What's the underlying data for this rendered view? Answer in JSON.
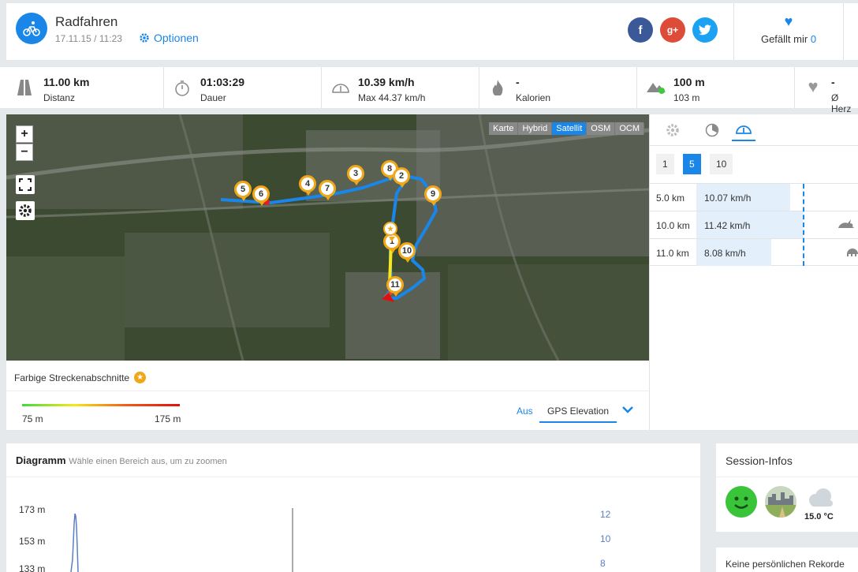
{
  "header": {
    "title": "Radfahren",
    "datetime": "17.11.15 / 11:23",
    "options_label": "Optionen",
    "like_label": "Gefällt mir",
    "like_count": "0"
  },
  "stats": [
    {
      "icon": "road-icon",
      "value": "11.00 km",
      "label": "Distanz"
    },
    {
      "icon": "stopwatch-icon",
      "value": "01:03:29",
      "label": "Dauer"
    },
    {
      "icon": "speedometer-icon",
      "value": "10.39 km/h",
      "label": "Max 44.37 km/h"
    },
    {
      "icon": "flame-icon",
      "value": "-",
      "label": "Kalorien"
    },
    {
      "icon": "mountain-icon",
      "value": "100 m",
      "label": "103 m"
    },
    {
      "icon": "heart-icon",
      "value": "-",
      "label": "Ø Herz"
    }
  ],
  "map": {
    "zoom_in": "+",
    "zoom_out": "−",
    "layers": [
      "Karte",
      "Hybrid",
      "Satellit",
      "OSM",
      "OCM"
    ],
    "active_layer": "Satellit",
    "markers": [
      "5",
      "6",
      "4",
      "7",
      "3",
      "8",
      "2",
      "9",
      "1",
      "10",
      "11"
    ]
  },
  "map_footer": {
    "colored_label": "Farbige Streckenabschnitte",
    "min_elevation": "75 m",
    "max_elevation": "175 m",
    "off_label": "Aus",
    "gps_label": "GPS Elevation"
  },
  "splits": {
    "intervals": [
      "1",
      "5",
      "10"
    ],
    "active_interval": "5",
    "rows": [
      {
        "km": "5.0 km",
        "speed": "10.07 km/h",
        "fraction": 0.88
      },
      {
        "km": "10.0 km",
        "speed": "11.42 km/h",
        "fraction": 1.0
      },
      {
        "km": "11.0 km",
        "speed": "8.08 km/h",
        "fraction": 0.7
      }
    ]
  },
  "chart": {
    "title": "Diagramm",
    "hint": "Wähle einen Bereich aus, um zu zoomen",
    "y_left_ticks": [
      "173 m",
      "153 m",
      "133 m"
    ],
    "y_right_ticks": [
      "12",
      "10",
      "8"
    ]
  },
  "session": {
    "title": "Session-Infos",
    "temperature": "15.0 °C",
    "records": "Keine persönlichen Rekorde"
  },
  "colors": {
    "accent": "#1a86e8",
    "marker": "#f0a818",
    "route": "#1a86e8"
  }
}
